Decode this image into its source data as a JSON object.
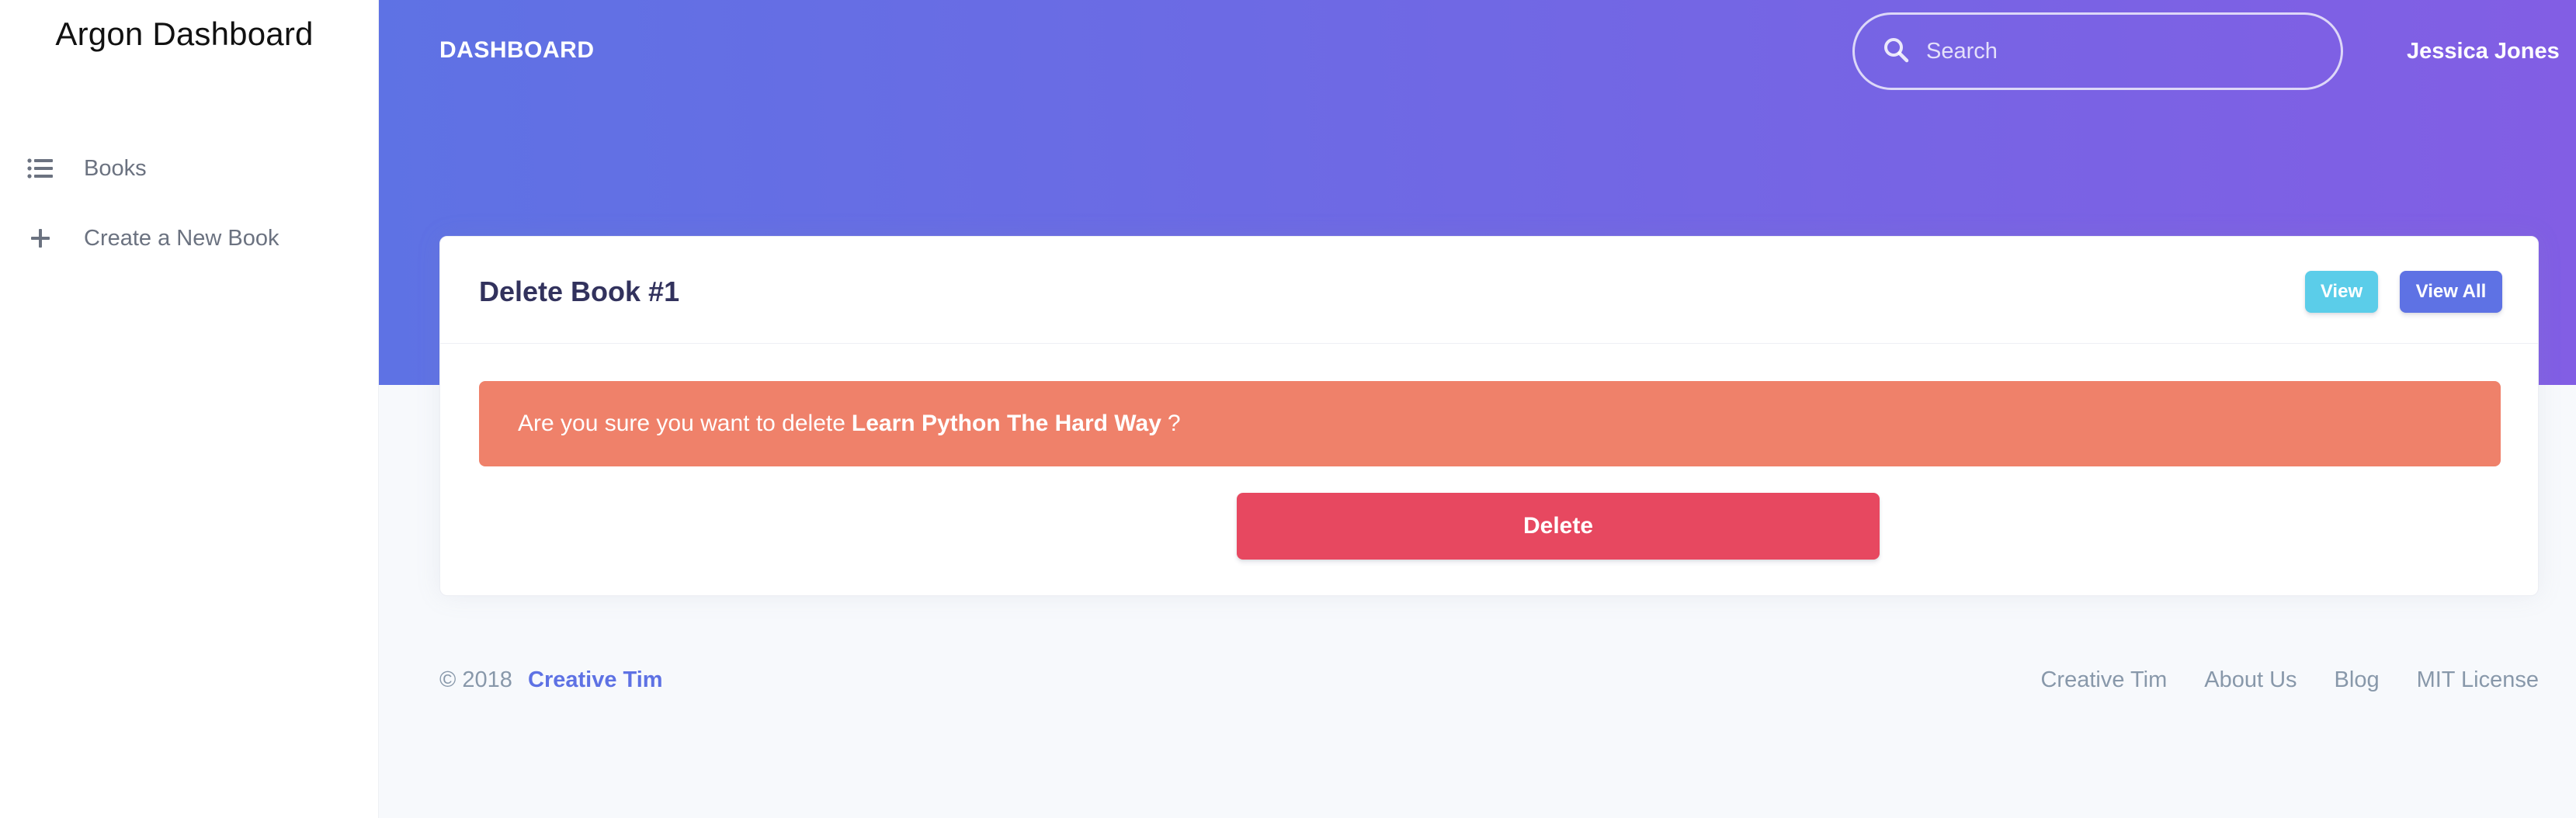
{
  "sidebar": {
    "brand": "Argon Dashboard",
    "items": [
      {
        "label": "Books",
        "icon": "list-icon"
      },
      {
        "label": "Create a New Book",
        "icon": "plus-icon"
      }
    ]
  },
  "header": {
    "title": "DASHBOARD",
    "search_placeholder": "Search",
    "user_name": "Jessica Jones"
  },
  "card": {
    "title": "Delete Book #1",
    "view_label": "View",
    "view_all_label": "View All",
    "alert_prefix": "Are you sure you want to delete",
    "book_title": "Learn Python The Hard Way",
    "alert_suffix": "?",
    "delete_label": "Delete"
  },
  "footer": {
    "copyright": "© 2018",
    "brand_link": "Creative Tim",
    "links": [
      "Creative Tim",
      "About Us",
      "Blog",
      "MIT License"
    ]
  },
  "colors": {
    "primary": "#5e72e4",
    "info": "#5bcde9",
    "warning": "#ef816a",
    "danger": "#e74860"
  }
}
